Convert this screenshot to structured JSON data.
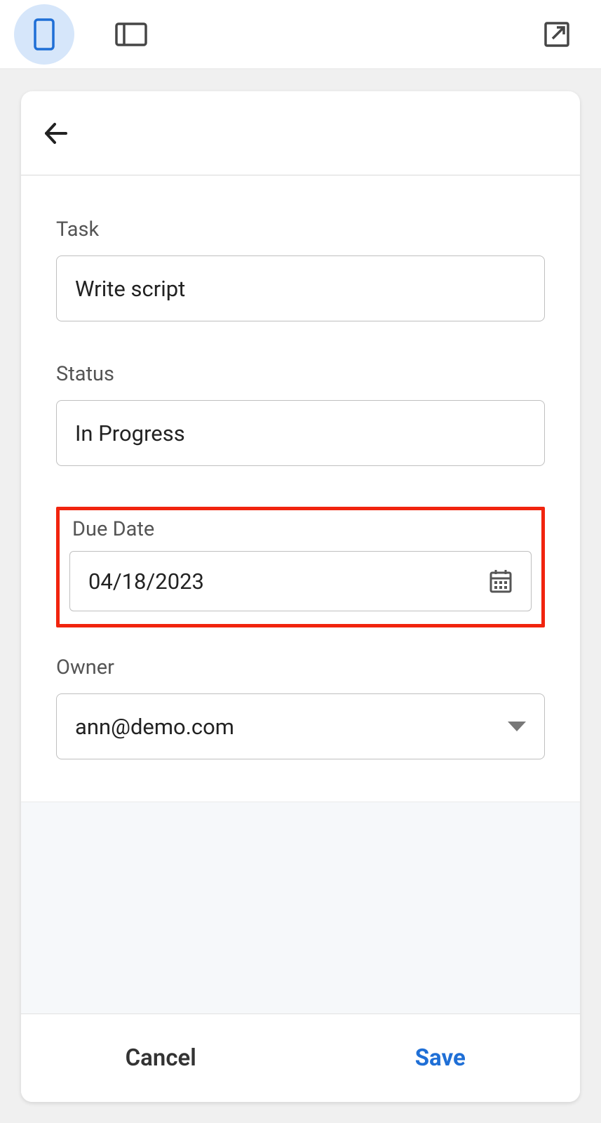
{
  "toolbar": {
    "mobile_active": true
  },
  "form": {
    "task": {
      "label": "Task",
      "value": "Write script"
    },
    "status": {
      "label": "Status",
      "value": "In Progress"
    },
    "due_date": {
      "label": "Due Date",
      "value": "04/18/2023"
    },
    "owner": {
      "label": "Owner",
      "value": "ann@demo.com"
    }
  },
  "actions": {
    "cancel_label": "Cancel",
    "save_label": "Save"
  }
}
